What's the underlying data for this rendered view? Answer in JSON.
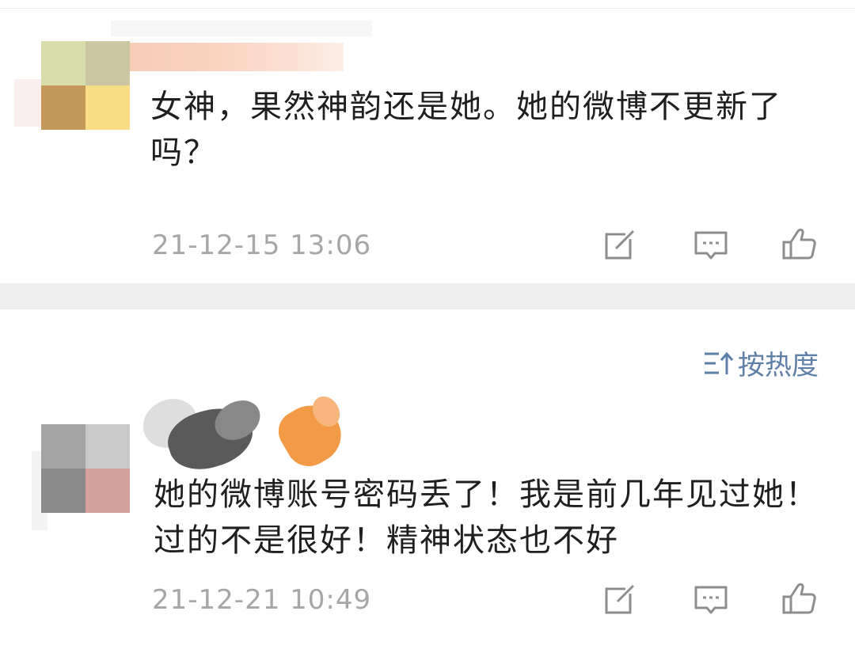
{
  "comments": [
    {
      "text": "女神，果然神韵还是她。她的微博不更新了吗？",
      "timestamp": "21-12-15 13:06",
      "avatar_colors": [
        "#d8dcaa",
        "#ccc7a2",
        "#c39858",
        "#f8dd86"
      ]
    },
    {
      "text": "她的微博账号密码丢了！我是前几年见过她！过的不是很好！精神状态也不好",
      "timestamp": "21-12-21 10:49",
      "avatar_colors": [
        "#a4a4a4",
        "#c9c9c9",
        "#8a8a8a",
        "#d3a39b"
      ]
    }
  ],
  "sort": {
    "label": "按热度",
    "icon": "sort-icon"
  },
  "actions": {
    "icons": [
      "share-edit-icon",
      "comment-icon",
      "like-icon"
    ],
    "icon_color": "#8e8e8e"
  },
  "colors": {
    "separator": "#eeeeee",
    "text": "#1f1f1f",
    "meta": "#a6a6a6",
    "accent": "#5d7fa8"
  }
}
